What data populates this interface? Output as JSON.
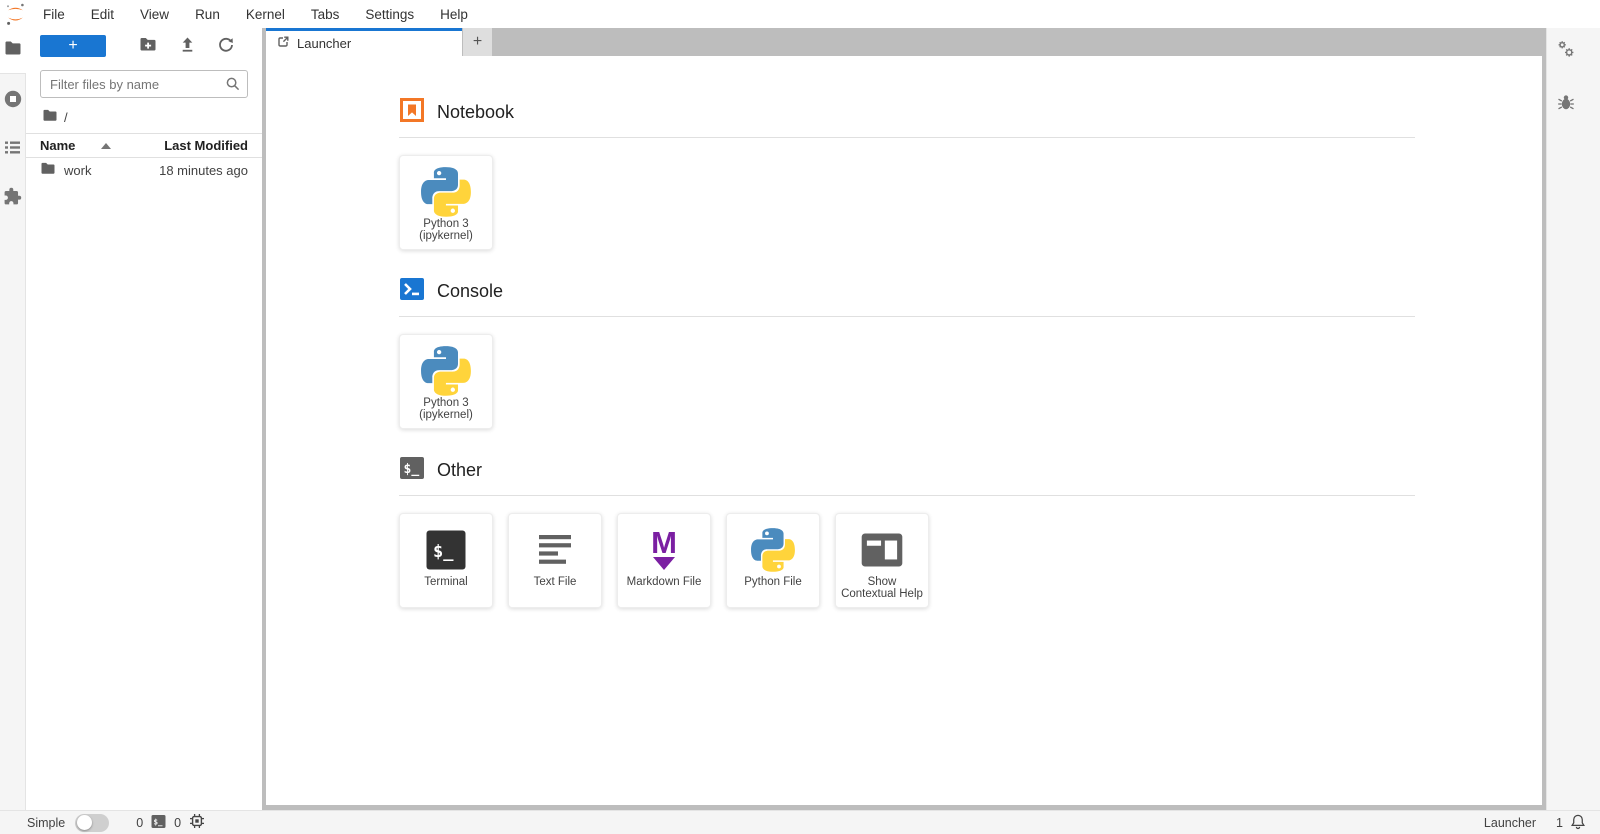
{
  "menu": {
    "items": [
      "File",
      "Edit",
      "View",
      "Run",
      "Kernel",
      "Tabs",
      "Settings",
      "Help"
    ]
  },
  "file_browser": {
    "filter_placeholder": "Filter files by name",
    "breadcrumb_root": "/",
    "columns": {
      "name": "Name",
      "last_modified": "Last Modified"
    },
    "rows": [
      {
        "name": "work",
        "last_modified": "18 minutes ago"
      }
    ]
  },
  "tab_bar": {
    "tabs": [
      {
        "label": "Launcher"
      }
    ]
  },
  "launcher": {
    "sections": [
      {
        "title": "Notebook",
        "cards": [
          {
            "label_lines": [
              "Python 3",
              "(ipykernel)"
            ]
          }
        ]
      },
      {
        "title": "Console",
        "cards": [
          {
            "label_lines": [
              "Python 3",
              "(ipykernel)"
            ]
          }
        ]
      },
      {
        "title": "Other",
        "cards": [
          {
            "label_lines": [
              "Terminal"
            ]
          },
          {
            "label_lines": [
              "Text File"
            ]
          },
          {
            "label_lines": [
              "Markdown File"
            ]
          },
          {
            "label_lines": [
              "Python File"
            ]
          },
          {
            "label_lines": [
              "Show",
              "Contextual Help"
            ]
          }
        ]
      }
    ]
  },
  "status_bar": {
    "mode_label": "Simple",
    "terminals_count": "0",
    "kernels_count": "0",
    "current_activity": "Launcher",
    "notifications_count": "1"
  },
  "icons": {
    "plus": "+",
    "terminal_glyph": "$_",
    "markdown_glyph": "M"
  },
  "colors": {
    "accent_blue": "#1976d2",
    "jupyter_orange": "#f37726",
    "python_blue": "#4b8bbe",
    "python_yellow": "#ffd43b",
    "markdown_purple": "#7b1fa2",
    "terminal_dark": "#333333",
    "tabbar_gray": "#bdbdbd"
  }
}
